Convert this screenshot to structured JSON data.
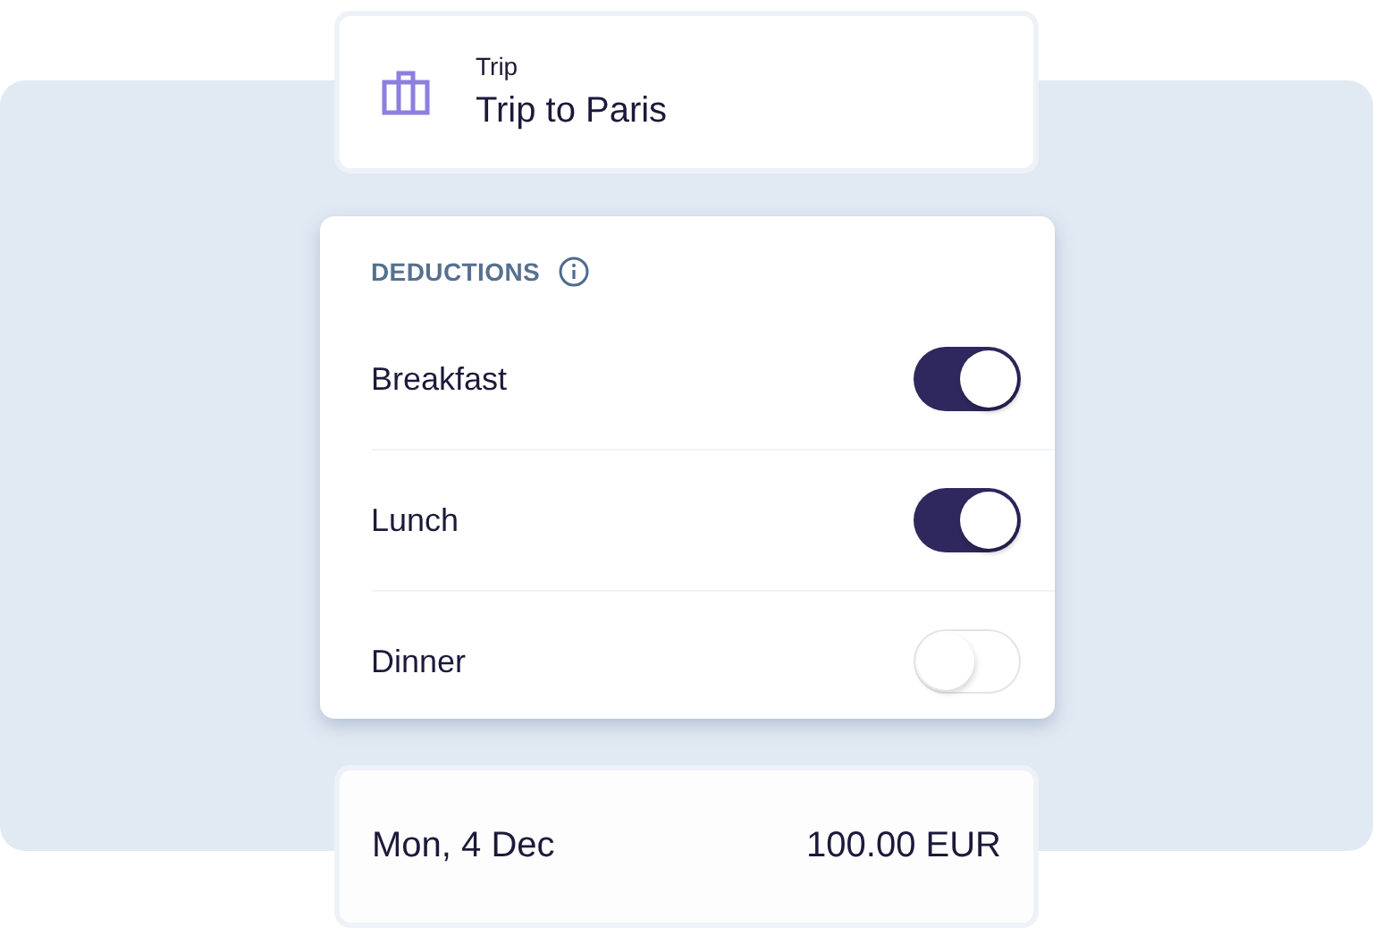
{
  "trip": {
    "label": "Trip",
    "value": "Trip to Paris"
  },
  "deductions": {
    "title": "DEDUCTIONS",
    "items": [
      {
        "label": "Breakfast",
        "on": true
      },
      {
        "label": "Lunch",
        "on": true
      },
      {
        "label": "Dinner",
        "on": false
      }
    ]
  },
  "summary": {
    "date": "Mon, 4 Dec",
    "amount": "100.00 EUR"
  }
}
